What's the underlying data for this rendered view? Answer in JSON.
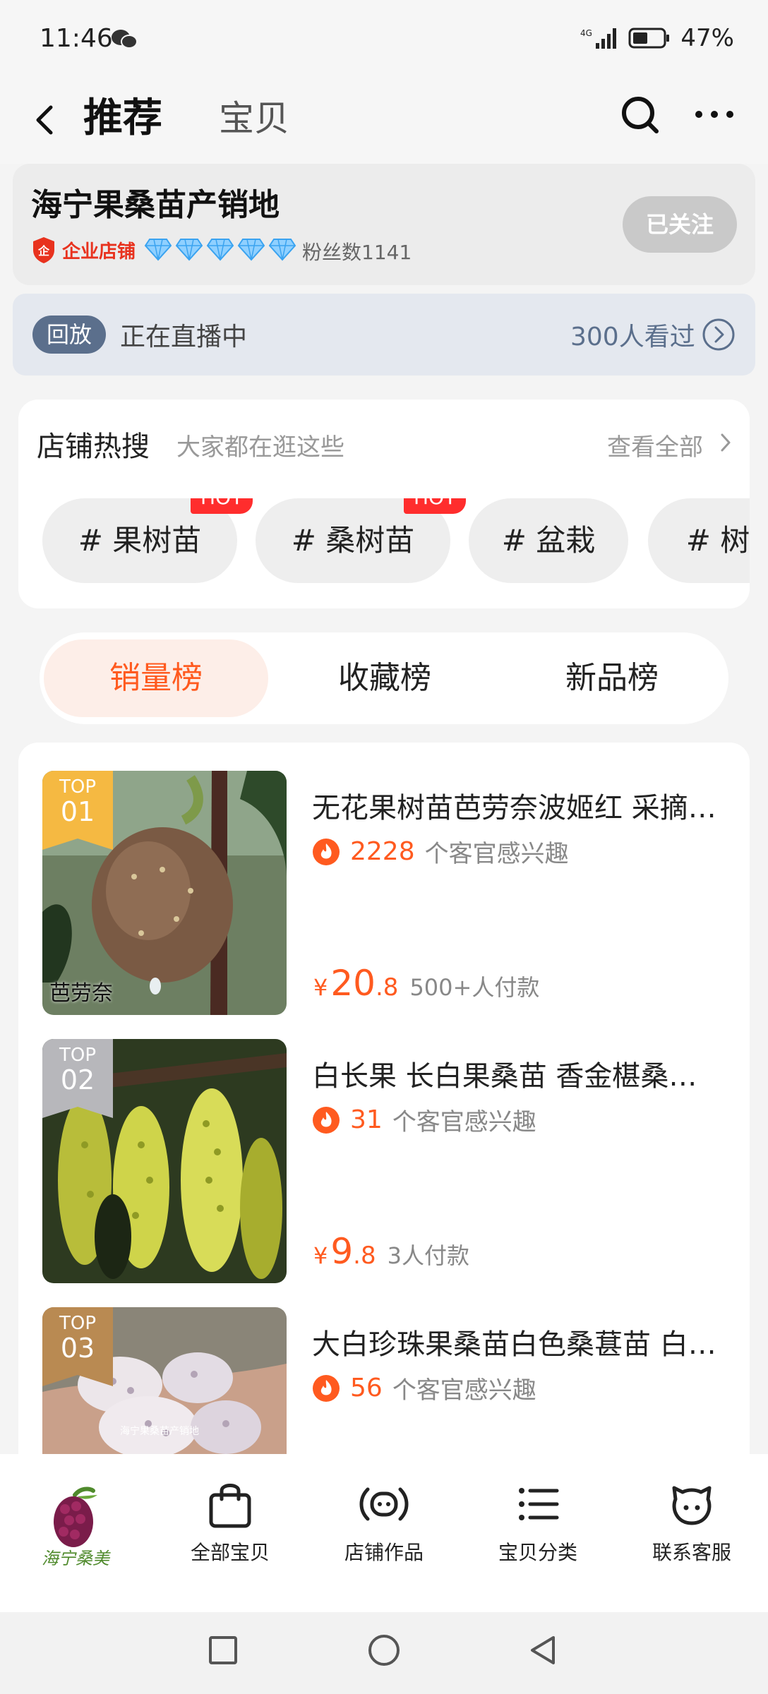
{
  "status_bar": {
    "time": "11:46",
    "battery": "47%"
  },
  "header": {
    "tab_recommend": "推荐",
    "tab_items": "宝贝"
  },
  "shop": {
    "name": "海宁果桑苗产销地",
    "badge": "企业店铺",
    "fans": "粉丝数1141",
    "follow_label": "已关注"
  },
  "live": {
    "badge": "回放",
    "status": "正在直播中",
    "viewers": "300人看过"
  },
  "hot_search": {
    "title": "店铺热搜",
    "subtitle": "大家都在逛这些",
    "view_all": "查看全部",
    "hot_badge": "HOT",
    "tags": [
      "# 果树苗",
      "# 桑树苗",
      "# 盆栽",
      "# 树苗"
    ]
  },
  "rank_tabs": [
    "销量榜",
    "收藏榜",
    "新品榜"
  ],
  "products": [
    {
      "rank_top": "TOP",
      "rank_num": "01",
      "image_caption": "芭劳奈",
      "title": "无花果树苗芭劳奈波姬红 采摘…",
      "interest_num": "2228",
      "interest_label": "个客官感兴趣",
      "yen": "¥",
      "price_int": "20",
      "price_dec": ".8",
      "paid": "500+人付款"
    },
    {
      "rank_top": "TOP",
      "rank_num": "02",
      "title": "白长果 长白果桑苗 香金椹桑…",
      "interest_num": "31",
      "interest_label": "个客官感兴趣",
      "yen": "¥",
      "price_int": "9",
      "price_dec": ".8",
      "paid": "3人付款"
    },
    {
      "rank_top": "TOP",
      "rank_num": "03",
      "image_caption": "海宁果桑苗产销地",
      "title": "大白珍珠果桑苗白色桑葚苗 白…",
      "interest_num": "56",
      "interest_label": "个客官感兴趣"
    }
  ],
  "bottom_nav": {
    "logo_text": "海宁桑美",
    "items": [
      "全部宝贝",
      "店铺作品",
      "宝贝分类",
      "联系客服"
    ]
  },
  "colors": {
    "accent": "#ff5a1f",
    "hot": "#ff2d2d",
    "live_blue": "#5b6f8c",
    "gold": "#f5b942",
    "silver": "#b7b7bb",
    "bronze": "#b98a52"
  }
}
